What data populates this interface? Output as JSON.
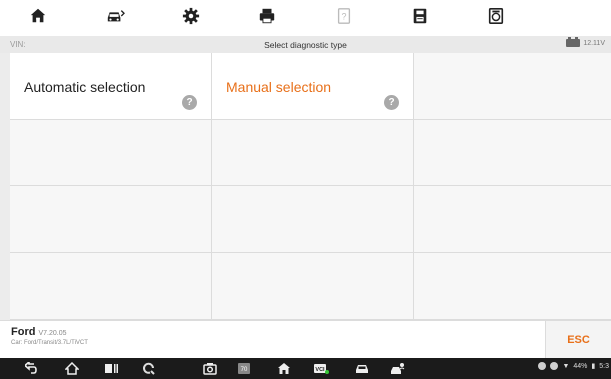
{
  "toolbar": {
    "items": [
      {
        "icon": "home-icon"
      },
      {
        "icon": "vehicle-swap-icon"
      },
      {
        "icon": "settings-icon"
      },
      {
        "icon": "print-icon"
      },
      {
        "icon": "help-disabled-icon"
      },
      {
        "icon": "save-icon"
      },
      {
        "icon": "data-log-icon"
      }
    ]
  },
  "titlebar": {
    "vin": "VIN:",
    "title": "Select diagnostic type",
    "voltage": "12.11V"
  },
  "options": [
    {
      "label": "Automatic selection",
      "help": "?"
    },
    {
      "label": "Manual selection",
      "help": "?"
    }
  ],
  "footer": {
    "brand": "Ford",
    "version": "V7.20.05",
    "car": "Car: Ford/Transit/3.7L/TiVCT",
    "esc": "ESC"
  },
  "statusbar": {
    "battery": "44%",
    "time": "5:3"
  },
  "colors": {
    "accent": "#e8701a",
    "toolbar_icon": "#222222",
    "navbar": "#1b1b1b"
  }
}
